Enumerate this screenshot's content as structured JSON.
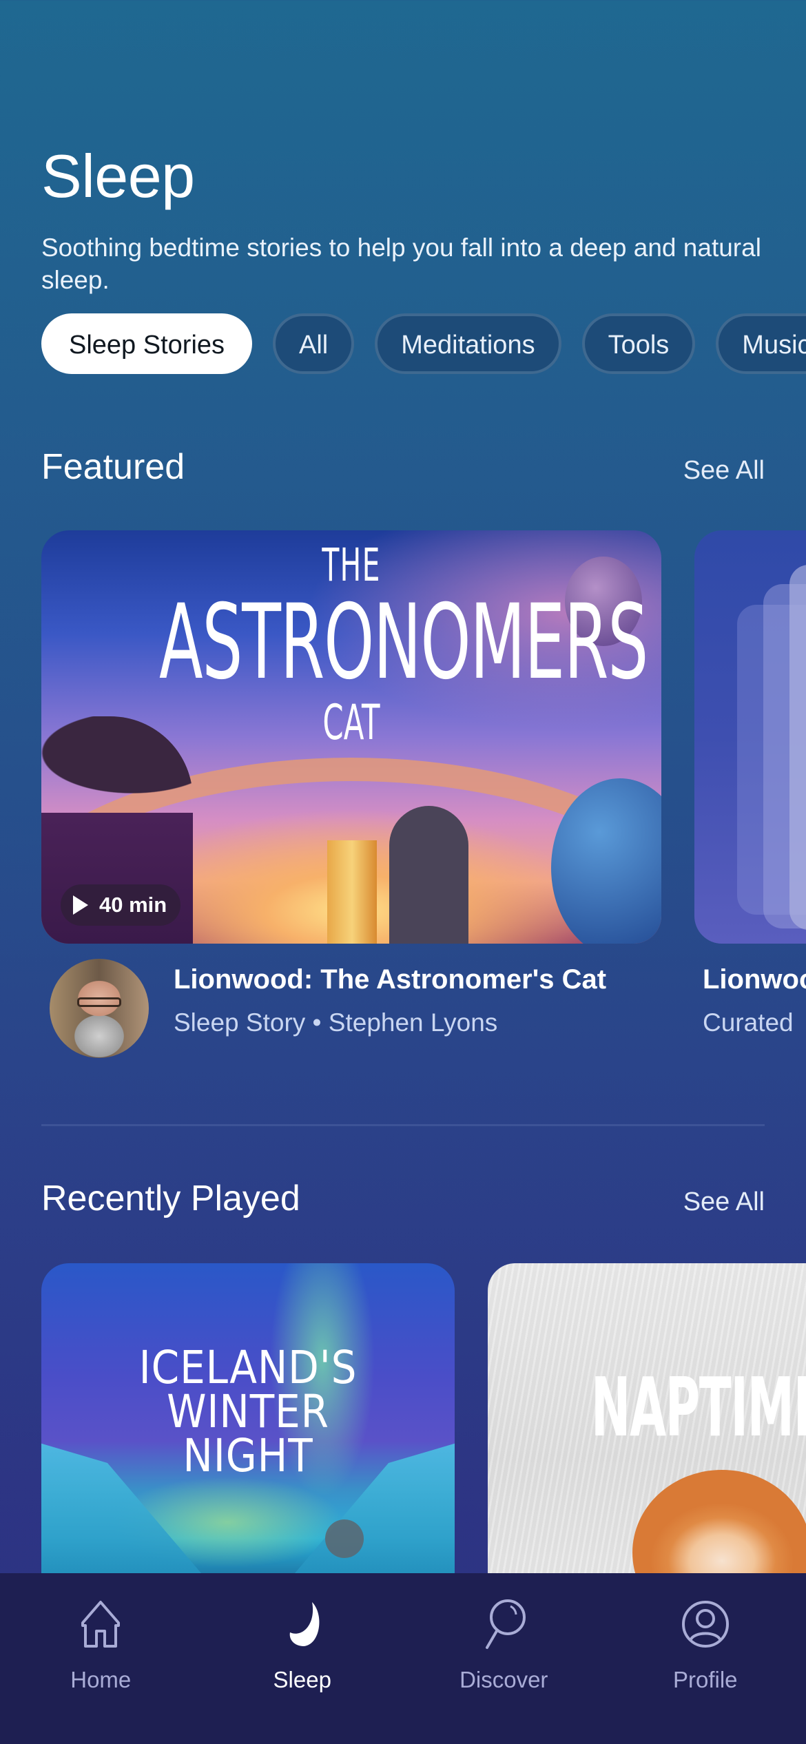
{
  "header": {
    "title": "Sleep",
    "subtitle": "Soothing bedtime stories to help you fall into a deep and natural sleep."
  },
  "filters": {
    "selected": "Sleep Stories",
    "chips": [
      {
        "label": "Sleep Stories",
        "active": true
      },
      {
        "label": "All",
        "active": false
      },
      {
        "label": "Meditations",
        "active": false
      },
      {
        "label": "Tools",
        "active": false
      },
      {
        "label": "Music",
        "active": false
      }
    ]
  },
  "featured": {
    "title": "Featured",
    "see_all": "See All",
    "items": [
      {
        "art_title_line1": "THE",
        "art_title_line2": "ASTRONOMERS",
        "art_title_line3": "CAT",
        "duration": "40 min",
        "title": "Lionwood: The Astronomer's Cat",
        "subtitle": "Sleep Story • Stephen Lyons",
        "narrator": "Stephen Lyons"
      },
      {
        "title": "Lionwoo",
        "subtitle": "Curated"
      }
    ]
  },
  "recently_played": {
    "title": "Recently Played",
    "see_all": "See All",
    "items": [
      {
        "art_title": "ICELAND'S WINTER NIGHT"
      },
      {
        "art_title": "NAPTIME"
      }
    ]
  },
  "tabbar": {
    "active": "Sleep",
    "items": [
      {
        "label": "Home",
        "icon": "home-icon"
      },
      {
        "label": "Sleep",
        "icon": "moon-icon"
      },
      {
        "label": "Discover",
        "icon": "search-icon"
      },
      {
        "label": "Profile",
        "icon": "profile-icon"
      }
    ]
  },
  "colors": {
    "background_top": "#1f6891",
    "background_bottom": "#2c3181",
    "tabbar": "#1e1f52",
    "chip_bg": "#1d4b78",
    "chip_active_bg": "#ffffff",
    "tab_inactive": "#a9acd6"
  }
}
